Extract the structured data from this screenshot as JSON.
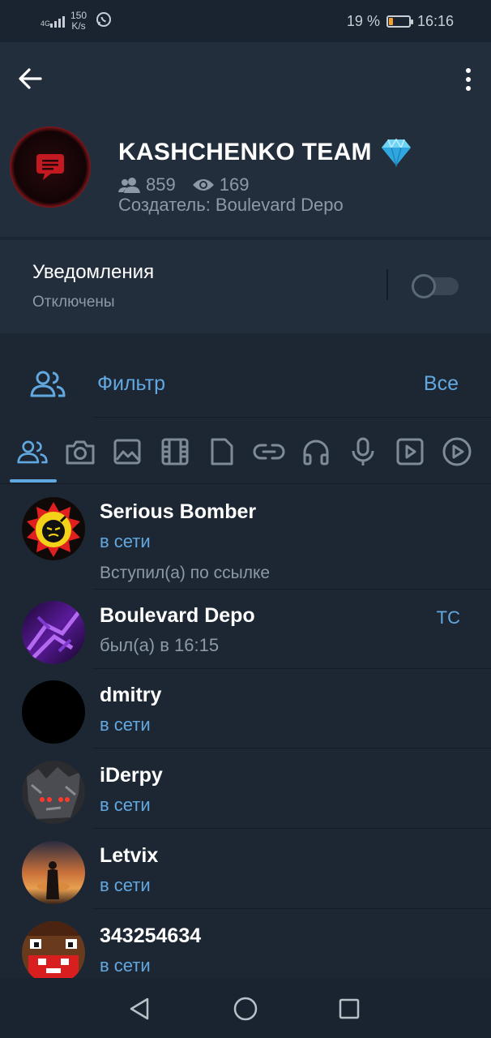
{
  "status_bar": {
    "network": "4G",
    "speed_value": "150",
    "speed_unit": "K/s",
    "battery_percent": "19 %",
    "battery_level": 0.19,
    "time": "16:16"
  },
  "header": {
    "title": "KASHCHENKO TEAM",
    "members_count": "859",
    "online_count": "169",
    "creator": "Создатель: Boulevard Depo"
  },
  "notifications": {
    "title": "Уведомления",
    "status": "Отключены",
    "enabled": false
  },
  "filter": {
    "label": "Фильтр",
    "value": "Все"
  },
  "tabs": [
    "members-icon",
    "camera-icon",
    "image-icon",
    "film-icon",
    "file-icon",
    "link-icon",
    "headphones-icon",
    "microphone-icon",
    "video-icon",
    "play-circle-icon"
  ],
  "members": [
    {
      "name": "Serious Bomber",
      "status": "в сети",
      "extra": "Вступил(а) по ссылке"
    },
    {
      "name": "Boulevard Depo",
      "status": "был(а) в 16:15",
      "tag": "ТС"
    },
    {
      "name": "dmitry",
      "status": "в сети"
    },
    {
      "name": "iDerpy",
      "status": "в сети"
    },
    {
      "name": "Letvix",
      "status": "в сети"
    },
    {
      "name": "343254634",
      "status": "в сети"
    }
  ],
  "colors": {
    "background": "#1d2733",
    "header": "#232e3c",
    "accent": "#62a8e0",
    "muted": "#8d99a6"
  }
}
